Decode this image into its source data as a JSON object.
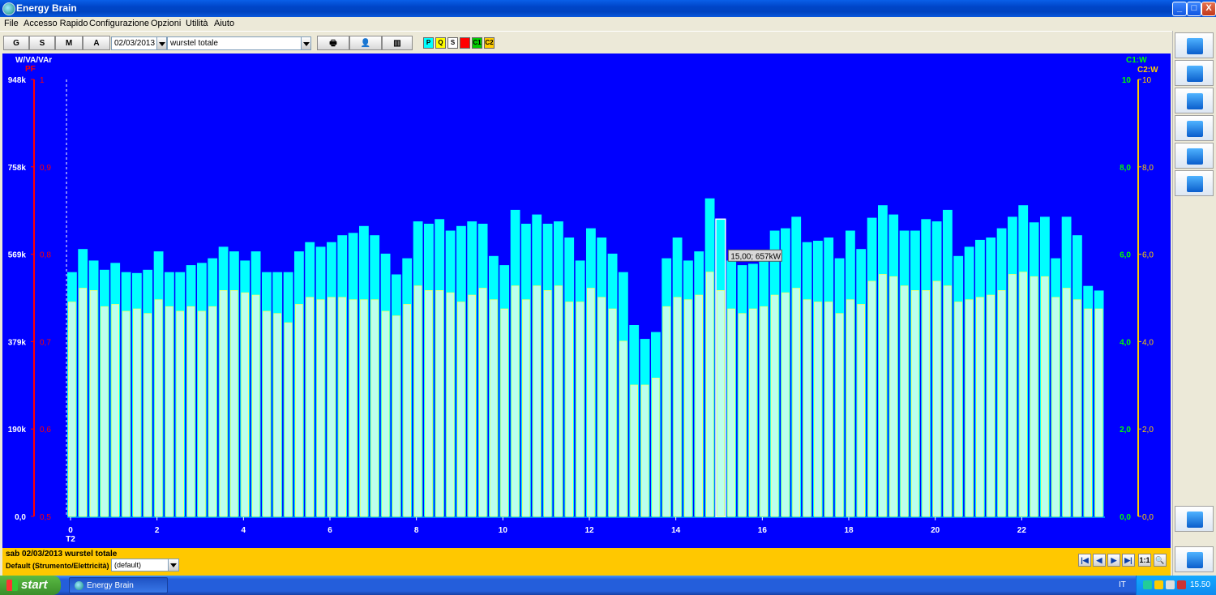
{
  "app": {
    "title": "Energy Brain"
  },
  "window_buttons": {
    "minimize": "_",
    "maximize": "□",
    "close": "X"
  },
  "menu": [
    "File",
    "Accesso Rapido",
    "Configurazione",
    "Opzioni",
    "Utilità",
    "Aiuto"
  ],
  "toolbar": {
    "periods": [
      "G",
      "S",
      "M",
      "A"
    ],
    "date": "02/03/2013",
    "device": "wurstel totale",
    "series_toggles": [
      {
        "label": "P",
        "color": "#00ffff"
      },
      {
        "label": "Q",
        "color": "#ffff00"
      },
      {
        "label": "S",
        "color": "#ffffff"
      },
      {
        "label": "",
        "color": "#ff0000"
      },
      {
        "label": "C1",
        "color": "#00cc00"
      },
      {
        "label": "C2",
        "color": "#ffcc00"
      }
    ]
  },
  "chart_data": {
    "type": "bar",
    "background": "#0000ff",
    "left_axis": {
      "label": "W/VA/VAr",
      "ticks": [
        "948k",
        "758k",
        "569k",
        "379k",
        "190k",
        "0,0"
      ],
      "ylim": [
        0,
        948
      ]
    },
    "pf_axis": {
      "label": "PF",
      "ticks": [
        "1",
        "0,9",
        "0,8",
        "0,7",
        "0,6",
        "0,5"
      ],
      "color": "#ff0000"
    },
    "right_axis_c1": {
      "label": "C1:W",
      "ticks": [
        "10",
        "8,0",
        "6,0",
        "4,0",
        "2,0",
        "0,0"
      ],
      "color": "#00ff00"
    },
    "right_axis_c2": {
      "label": "C2:W",
      "ticks": [
        "10",
        "8,0",
        "6,0",
        "4,0",
        "2,0",
        "0,0"
      ],
      "color": "#ffcc00"
    },
    "x_ticks": [
      "0",
      "2",
      "4",
      "6",
      "8",
      "10",
      "12",
      "14",
      "16",
      "18",
      "20",
      "22"
    ],
    "x_sublabel": "T2",
    "x_range": [
      0,
      24
    ],
    "series": [
      {
        "name": "P",
        "color": "#00ffff",
        "values": [
          530,
          580,
          555,
          535,
          550,
          530,
          528,
          535,
          575,
          530,
          530,
          545,
          550,
          560,
          585,
          575,
          555,
          575,
          530,
          530,
          530,
          575,
          595,
          585,
          595,
          610,
          615,
          630,
          610,
          570,
          525,
          560,
          640,
          635,
          645,
          620,
          630,
          640,
          635,
          565,
          545,
          665,
          635,
          655,
          635,
          640,
          605,
          555,
          625,
          605,
          570,
          530,
          415,
          385,
          400,
          560,
          605,
          555,
          575,
          690,
          645,
          555,
          545,
          548,
          555,
          620,
          625,
          650,
          595,
          598,
          605,
          560,
          620,
          580,
          648,
          675,
          655,
          620,
          620,
          645,
          640,
          665,
          565,
          585,
          600,
          605,
          625,
          650,
          675,
          638,
          650,
          560,
          650,
          610,
          500,
          490
        ]
      },
      {
        "name": "Q",
        "color": "#bbffee",
        "values": [
          465,
          495,
          490,
          455,
          460,
          445,
          450,
          440,
          470,
          455,
          445,
          455,
          445,
          455,
          490,
          490,
          485,
          480,
          445,
          440,
          420,
          460,
          475,
          470,
          475,
          475,
          470,
          470,
          470,
          445,
          435,
          460,
          500,
          490,
          490,
          485,
          465,
          480,
          495,
          470,
          450,
          500,
          470,
          500,
          490,
          500,
          465,
          465,
          495,
          475,
          450,
          380,
          285,
          285,
          300,
          455,
          475,
          470,
          480,
          530,
          490,
          450,
          440,
          450,
          455,
          480,
          485,
          495,
          470,
          465,
          465,
          440,
          470,
          460,
          510,
          525,
          520,
          500,
          490,
          490,
          510,
          500,
          465,
          470,
          475,
          480,
          490,
          525,
          530,
          520,
          520,
          475,
          495,
          470,
          450,
          450
        ]
      }
    ],
    "highlight_index": 60,
    "tooltip": "15,00; 657kW"
  },
  "right_panel": [
    "chart-icon",
    "list-icon",
    "formula-icon",
    "table-icon",
    "hde-icon",
    "report-icon",
    "hd-chart-icon",
    "exit-icon"
  ],
  "status": {
    "line1": "sab 02/03/2013  wurstel totale",
    "line2": "Default (Strumento/Elettricità)",
    "profile": "(default)",
    "nav": [
      "|◀",
      "◀",
      "▶",
      "▶|",
      "1:1",
      "🔍"
    ]
  },
  "taskbar": {
    "start": "start",
    "item": "Energy Brain",
    "lang": "IT",
    "time": "15.50"
  }
}
